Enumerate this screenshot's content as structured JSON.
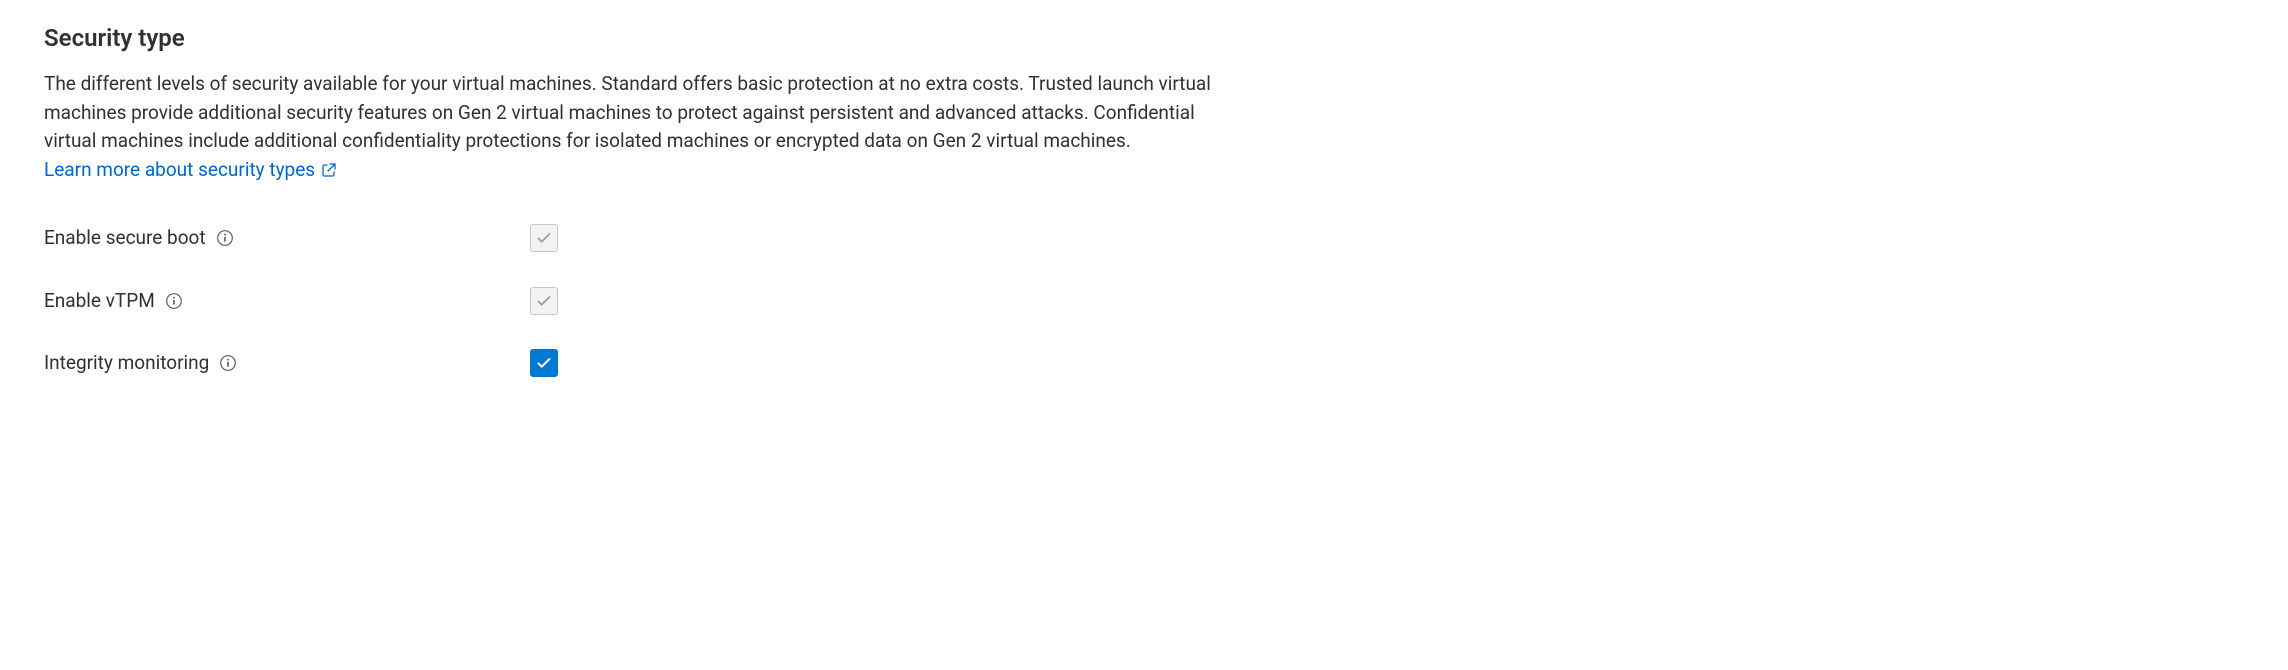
{
  "section": {
    "heading": "Security type",
    "description": "The different levels of security available for your virtual machines. Standard offers basic protection at no extra costs. Trusted launch virtual machines provide additional security features on Gen 2 virtual machines to protect against persistent and advanced attacks. Confidential virtual machines include additional confidentiality protections for isolated machines or encrypted data on Gen 2 virtual machines.",
    "link_text": "Learn more about security types"
  },
  "options": {
    "secure_boot": {
      "label": "Enable secure boot",
      "checked": true,
      "disabled": true
    },
    "vtpm": {
      "label": "Enable vTPM",
      "checked": true,
      "disabled": true
    },
    "integrity_monitoring": {
      "label": "Integrity monitoring",
      "checked": true,
      "disabled": false
    }
  },
  "colors": {
    "accent": "#0078d4",
    "link": "#0066cc",
    "text": "#323130",
    "disabled_bg": "#f3f2f1",
    "disabled_border": "#c8c6c4",
    "disabled_check": "#a19f9d"
  }
}
